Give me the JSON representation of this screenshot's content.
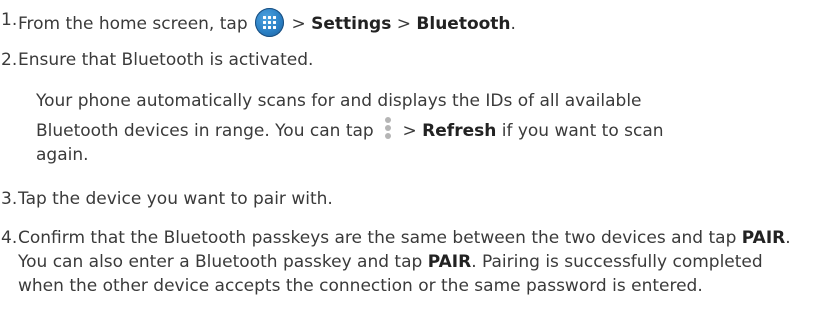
{
  "steps": [
    {
      "number": "1.",
      "part1": "From the home screen, tap",
      "sep1": ">",
      "settings": "Settings",
      "sep2": ">",
      "bluetooth": "Bluetooth",
      "end": "."
    },
    {
      "number": "2.",
      "text": "Ensure that Bluetooth is activated."
    },
    {
      "number": "3.",
      "text": "Tap the device you want to pair with."
    },
    {
      "number": "4.",
      "part1": "Confirm that the Bluetooth passkeys are the same between the two devices and tap",
      "pair1": "PAIR",
      "part2": ". You can also enter a Bluetooth passkey and tap",
      "pair2": "PAIR",
      "part3": ". Pairing is successfully completed when the other device accepts the connection or the same password is entered."
    }
  ],
  "note": {
    "line1": "Your phone automatically scans for and displays the IDs of all available",
    "line2a": "Bluetooth devices in range. You can tap",
    "line2b": ">",
    "refresh": "Refresh",
    "line2c": "if you want to scan",
    "line3": "again."
  },
  "icons": {
    "apps": "apps-grid-icon",
    "menu": "overflow-menu-icon"
  },
  "colors": {
    "text": "#3a3a3a",
    "apps_icon": "#2a7fc4",
    "menu_icon": "#b5b5b5"
  }
}
